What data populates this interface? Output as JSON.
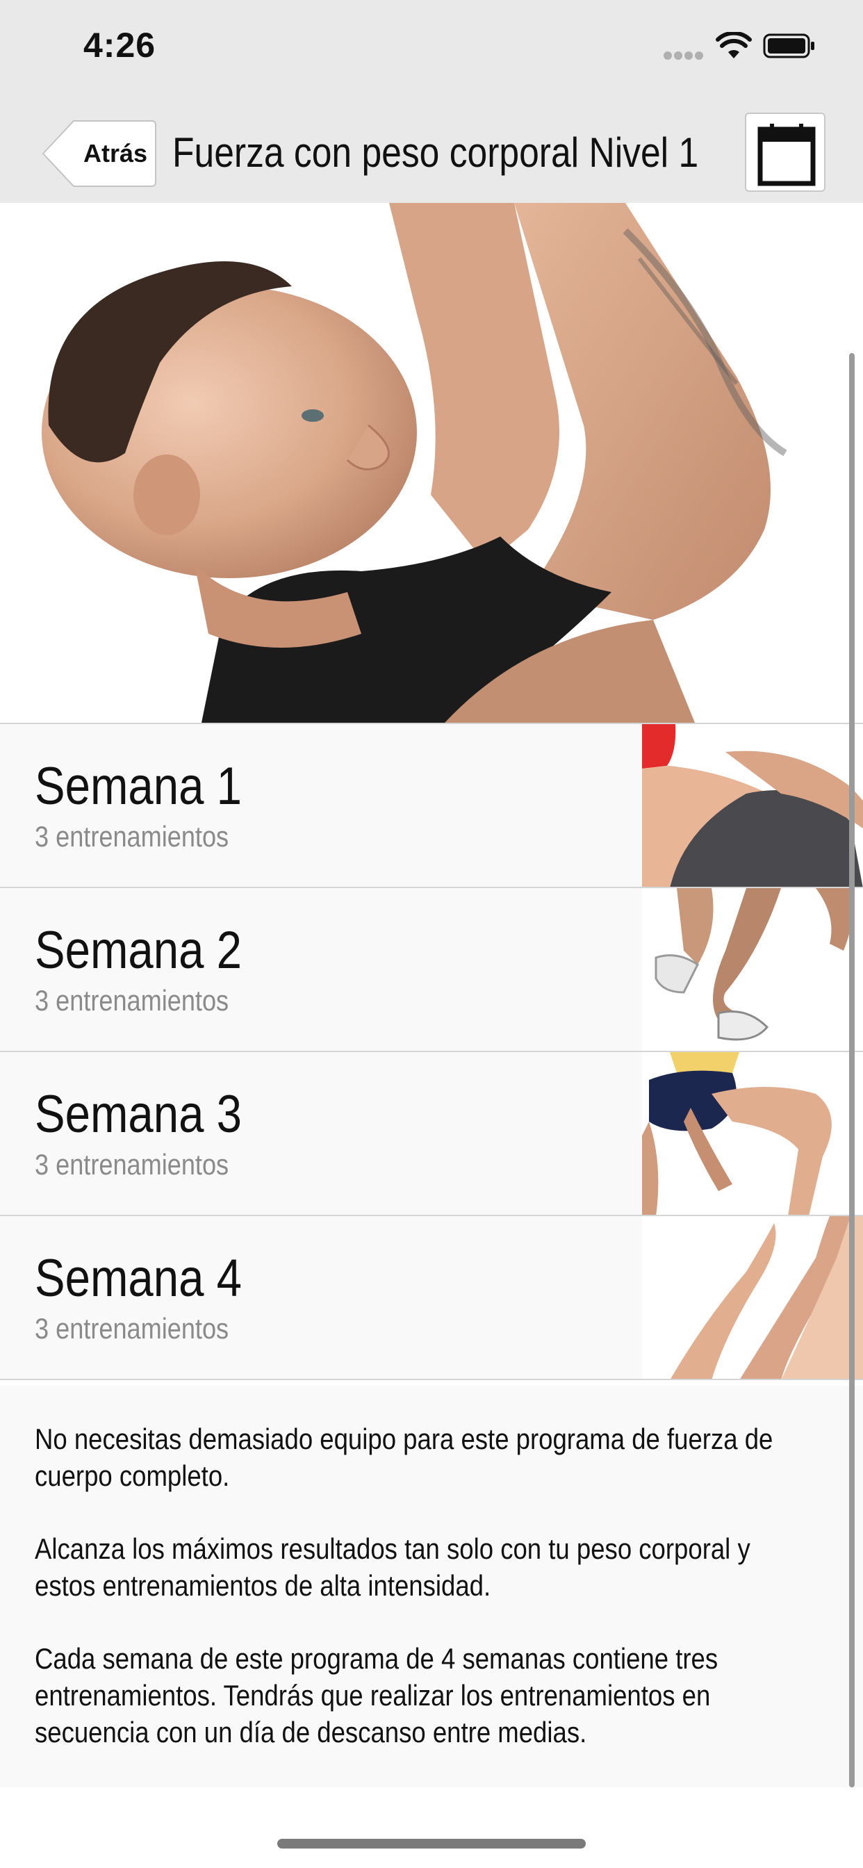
{
  "status_bar": {
    "time": "4:26"
  },
  "nav": {
    "back_label": "Atrás",
    "title": "Fuerza con peso corporal Nivel 1"
  },
  "weeks": [
    {
      "title": "Semana 1",
      "subtitle": "3 entrenamientos"
    },
    {
      "title": "Semana 2",
      "subtitle": "3 entrenamientos"
    },
    {
      "title": "Semana 3",
      "subtitle": "3 entrenamientos"
    },
    {
      "title": "Semana 4",
      "subtitle": "3 entrenamientos"
    }
  ],
  "description": {
    "paragraphs": [
      "No necesitas demasiado equipo para este programa de fuerza de cuerpo completo.",
      "Alcanza los máximos resultados tan solo con tu peso corporal y estos entrenamientos de alta intensidad.",
      "Cada semana de este programa de 4 semanas contiene tres entrenamientos. Tendrás que realizar los entrenamientos en secuencia con un día de descanso entre medias."
    ]
  },
  "icons": {
    "wifi": "wifi-icon",
    "battery": "battery-icon",
    "back": "chevron-left-icon",
    "calendar": "calendar-icon"
  },
  "colors": {
    "bar_background": "#e9e9e9",
    "row_background": "#f9f9f9",
    "subtitle_gray": "#8a8a8a"
  }
}
